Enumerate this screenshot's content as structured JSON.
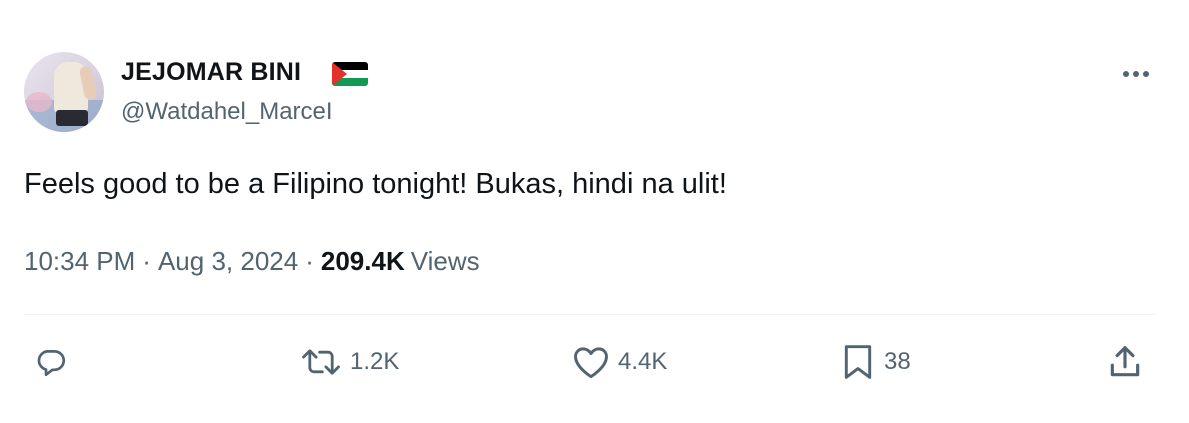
{
  "author": {
    "display_name": "JEJOMAR BINI",
    "handle": "@Watdahel_MarceI",
    "badge_icon": "palestine-flag-icon"
  },
  "tweet": {
    "text": "Feels good to be a Filipino tonight! Bukas, hindi na ulit!",
    "time": "10:34 PM",
    "separator": "·",
    "date": "Aug 3, 2024",
    "views_count": "209.4K",
    "views_label": "Views"
  },
  "actions": {
    "reply": {
      "icon": "reply-icon",
      "count": ""
    },
    "retweet": {
      "icon": "retweet-icon",
      "count": "1.2K"
    },
    "like": {
      "icon": "heart-icon",
      "count": "4.4K"
    },
    "bookmark": {
      "icon": "bookmark-icon",
      "count": "38"
    },
    "share": {
      "icon": "share-icon"
    }
  },
  "menu": {
    "icon": "more-options-icon"
  },
  "colors": {
    "text": "#0f1419",
    "secondary": "#536471",
    "divider": "#eff3f4",
    "background": "#ffffff"
  }
}
